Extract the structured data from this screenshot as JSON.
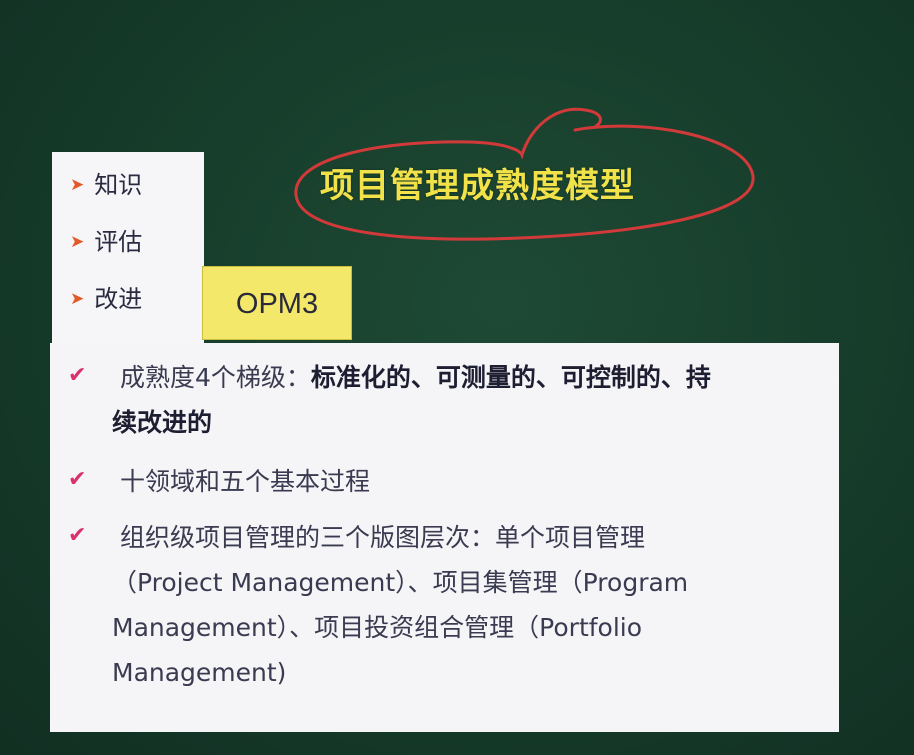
{
  "title": "项目管理成熟度模型",
  "top_list": {
    "items": [
      {
        "label": "知识"
      },
      {
        "label": "评估"
      },
      {
        "label": "改进"
      }
    ]
  },
  "opm_label": "OPM3",
  "main": {
    "item1": {
      "prefix": "成熟度4个梯级：",
      "bold_line1": "标准化的、可测量的、可控制的、持",
      "bold_line2": "续改进的"
    },
    "item2": {
      "text": "十领域和五个基本过程"
    },
    "item3": {
      "line1": "组织级项目管理的三个版图层次：单个项目管理",
      "line2": "（Project  Management）、项目集管理（Program",
      "line3": "Management）、项目投资组合管理（Portfolio",
      "line4": "Management)"
    }
  },
  "colors": {
    "background": "#173e2c",
    "title": "#f2e24a",
    "ellipse": "#d23a3a",
    "opm_box": "#f3e86a",
    "check": "#d9316a",
    "arrow": "#e35a2a"
  },
  "icons": {
    "list_arrow": "arrow-right-icon",
    "bullet": "check-icon"
  }
}
